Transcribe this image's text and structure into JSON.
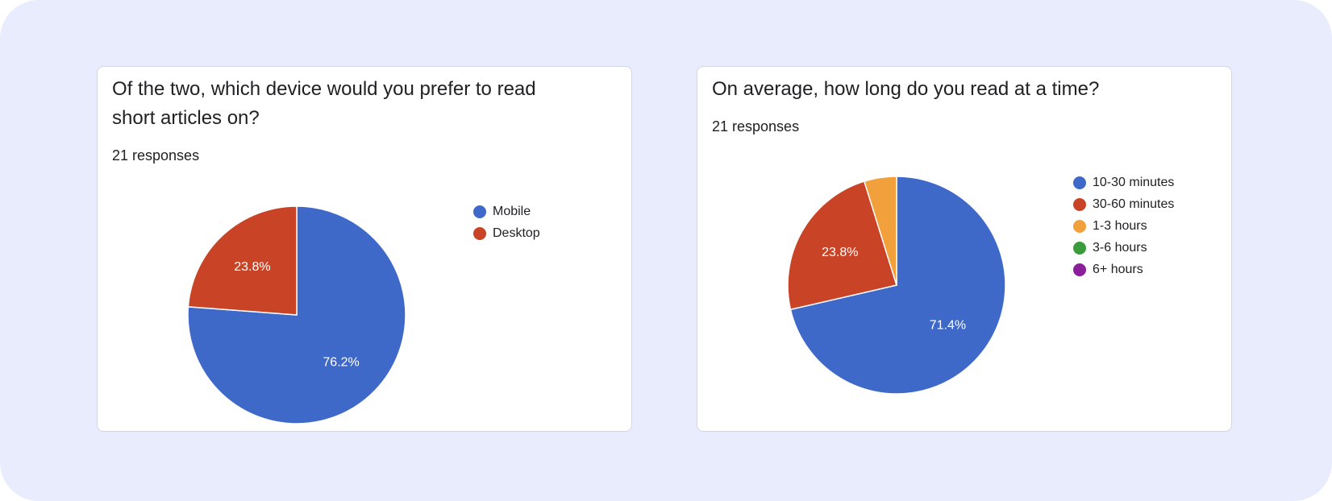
{
  "colors": {
    "page_background": "#e8ecfd",
    "card_background": "#ffffff",
    "card_border": "#d3d6e2",
    "text": "#202124",
    "slice_blue": "#3e69c8",
    "slice_red": "#c94426",
    "slice_orange": "#f1a03b",
    "slice_green": "#3b9a3a",
    "slice_purple": "#8a1f99"
  },
  "cards": [
    {
      "question": "Of the two, which device would you prefer to read short articles on?",
      "responses": "21 responses"
    },
    {
      "question": "On average, how long do you read at a time?",
      "responses": "21 responses"
    }
  ],
  "chart_data": [
    {
      "type": "pie",
      "title": "Of the two, which device would you prefer to read short articles on?",
      "subtitle": "21 responses",
      "legend_position": "right",
      "slices": [
        {
          "label": "Mobile",
          "value": 76.2,
          "display": "76.2%",
          "color": "#3e69c8"
        },
        {
          "label": "Desktop",
          "value": 23.8,
          "display": "23.8%",
          "color": "#c94426"
        }
      ]
    },
    {
      "type": "pie",
      "title": "On average, how long do you read at a time?",
      "subtitle": "21 responses",
      "legend_position": "right",
      "slices": [
        {
          "label": "10-30 minutes",
          "value": 71.4,
          "display": "71.4%",
          "color": "#3e69c8"
        },
        {
          "label": "30-60 minutes",
          "value": 23.8,
          "display": "23.8%",
          "color": "#c94426"
        },
        {
          "label": "1-3 hours",
          "value": 4.8,
          "display": "",
          "color": "#f1a03b"
        },
        {
          "label": "3-6 hours",
          "value": 0,
          "display": "",
          "color": "#3b9a3a"
        },
        {
          "label": "6+ hours",
          "value": 0,
          "display": "",
          "color": "#8a1f99"
        }
      ]
    }
  ]
}
